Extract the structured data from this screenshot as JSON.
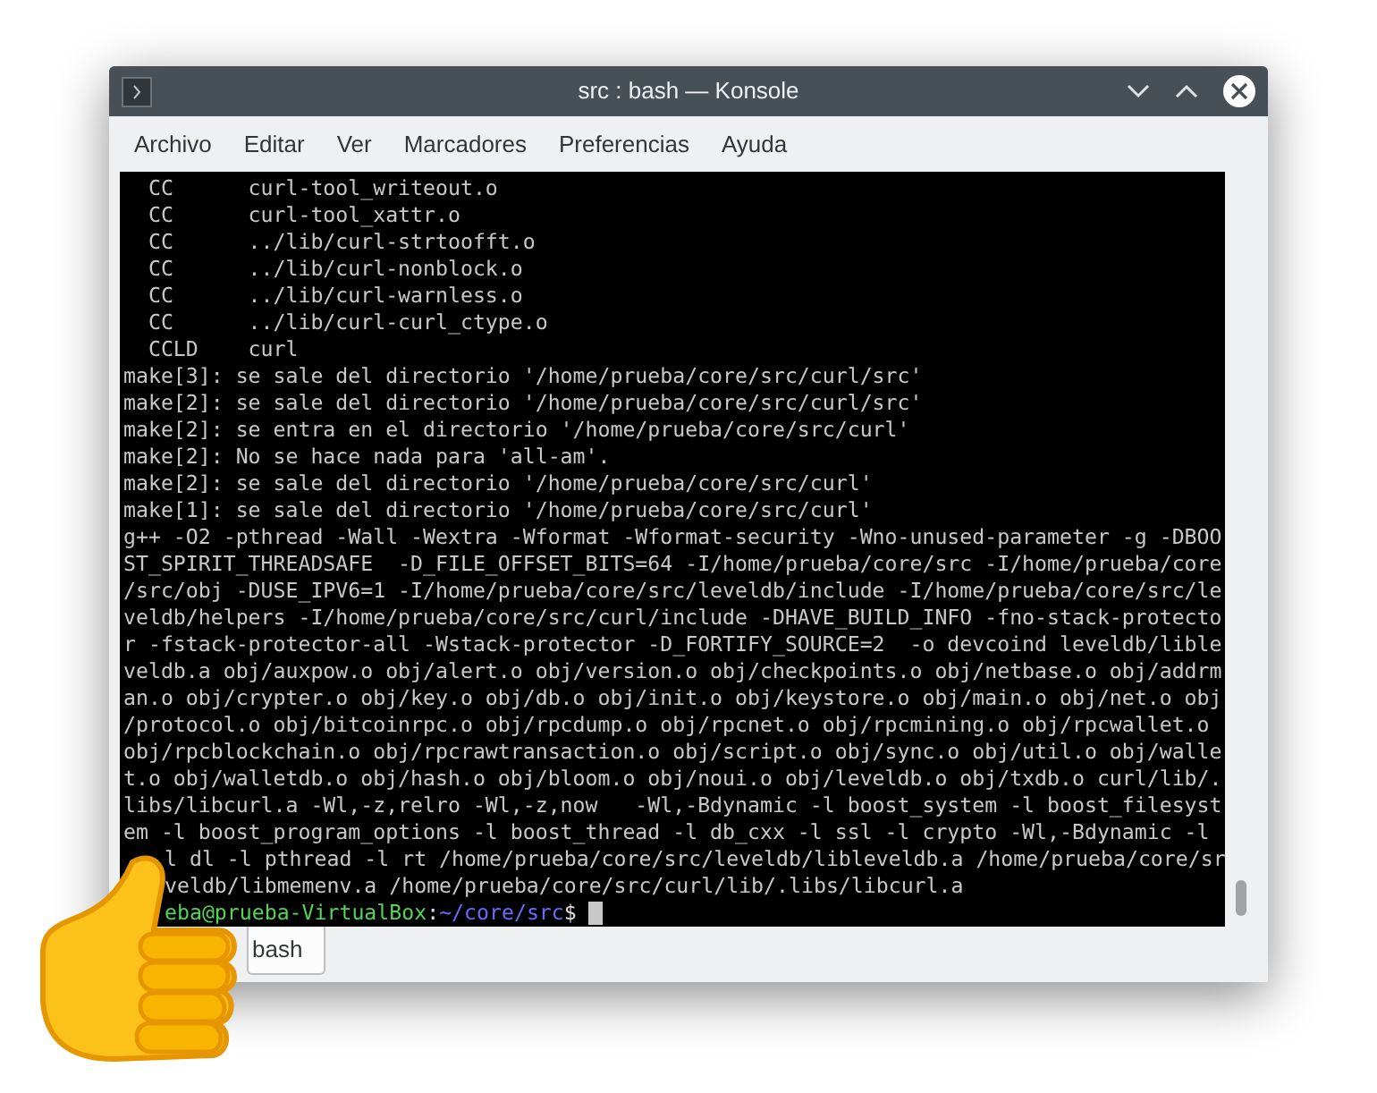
{
  "window": {
    "title": "src : bash — Konsole"
  },
  "menu": [
    "Archivo",
    "Editar",
    "Ver",
    "Marcadores",
    "Preferencias",
    "Ayuda"
  ],
  "terminal": {
    "lines": [
      {
        "kind": "output",
        "text": "  CC      curl-tool_writeout.o"
      },
      {
        "kind": "output",
        "text": "  CC      curl-tool_xattr.o"
      },
      {
        "kind": "output",
        "text": "  CC      ../lib/curl-strtoofft.o"
      },
      {
        "kind": "output",
        "text": "  CC      ../lib/curl-nonblock.o"
      },
      {
        "kind": "output",
        "text": "  CC      ../lib/curl-warnless.o"
      },
      {
        "kind": "output",
        "text": "  CC      ../lib/curl-curl_ctype.o"
      },
      {
        "kind": "output",
        "text": "  CCLD    curl"
      },
      {
        "kind": "output",
        "text": "make[3]: se sale del directorio '/home/prueba/core/src/curl/src'"
      },
      {
        "kind": "output",
        "text": "make[2]: se sale del directorio '/home/prueba/core/src/curl/src'"
      },
      {
        "kind": "output",
        "text": "make[2]: se entra en el directorio '/home/prueba/core/src/curl'"
      },
      {
        "kind": "output",
        "text": "make[2]: No se hace nada para 'all-am'."
      },
      {
        "kind": "output",
        "text": "make[2]: se sale del directorio '/home/prueba/core/src/curl'"
      },
      {
        "kind": "output",
        "text": "make[1]: se sale del directorio '/home/prueba/core/src/curl'"
      },
      {
        "kind": "output",
        "text": "g++ -O2 -pthread -Wall -Wextra -Wformat -Wformat-security -Wno-unused-parameter -g -DBOO"
      },
      {
        "kind": "output",
        "text": "ST_SPIRIT_THREADSAFE  -D_FILE_OFFSET_BITS=64 -I/home/prueba/core/src -I/home/prueba/core"
      },
      {
        "kind": "output",
        "text": "/src/obj -DUSE_IPV6=1 -I/home/prueba/core/src/leveldb/include -I/home/prueba/core/src/le"
      },
      {
        "kind": "output",
        "text": "veldb/helpers -I/home/prueba/core/src/curl/include -DHAVE_BUILD_INFO -fno-stack-protecto"
      },
      {
        "kind": "output",
        "text": "r -fstack-protector-all -Wstack-protector -D_FORTIFY_SOURCE=2  -o devcoind leveldb/lible"
      },
      {
        "kind": "output",
        "text": "veldb.a obj/auxpow.o obj/alert.o obj/version.o obj/checkpoints.o obj/netbase.o obj/addrm"
      },
      {
        "kind": "output",
        "text": "an.o obj/crypter.o obj/key.o obj/db.o obj/init.o obj/keystore.o obj/main.o obj/net.o obj"
      },
      {
        "kind": "output",
        "text": "/protocol.o obj/bitcoinrpc.o obj/rpcdump.o obj/rpcnet.o obj/rpcmining.o obj/rpcwallet.o"
      },
      {
        "kind": "output",
        "text": "obj/rpcblockchain.o obj/rpcrawtransaction.o obj/script.o obj/sync.o obj/util.o obj/walle"
      },
      {
        "kind": "output",
        "text": "t.o obj/walletdb.o obj/hash.o obj/bloom.o obj/noui.o obj/leveldb.o obj/txdb.o curl/lib/."
      },
      {
        "kind": "output",
        "text": "libs/libcurl.a -Wl,-z,relro -Wl,-z,now   -Wl,-Bdynamic -l boost_system -l boost_filesyst"
      },
      {
        "kind": "output",
        "text": "em -l boost_program_options -l boost_thread -l db_cxx -l ssl -l crypto -Wl,-Bdynamic -l"
      },
      {
        "kind": "covered",
        "text": "l dl -l pthread -l rt /home/prueba/core/src/leveldb/libleveldb.a /home/prueba/core/sr"
      },
      {
        "kind": "covered",
        "text": "veldb/libmemenv.a /home/prueba/core/src/curl/lib/.libs/libcurl.a"
      },
      {
        "kind": "prompt",
        "user": "eba@prueba-VirtualBox",
        "separator": ":",
        "path": "~/core/src",
        "symbol": "$"
      }
    ]
  },
  "tabs": [
    {
      "label": "bash",
      "selected": true
    }
  ]
}
